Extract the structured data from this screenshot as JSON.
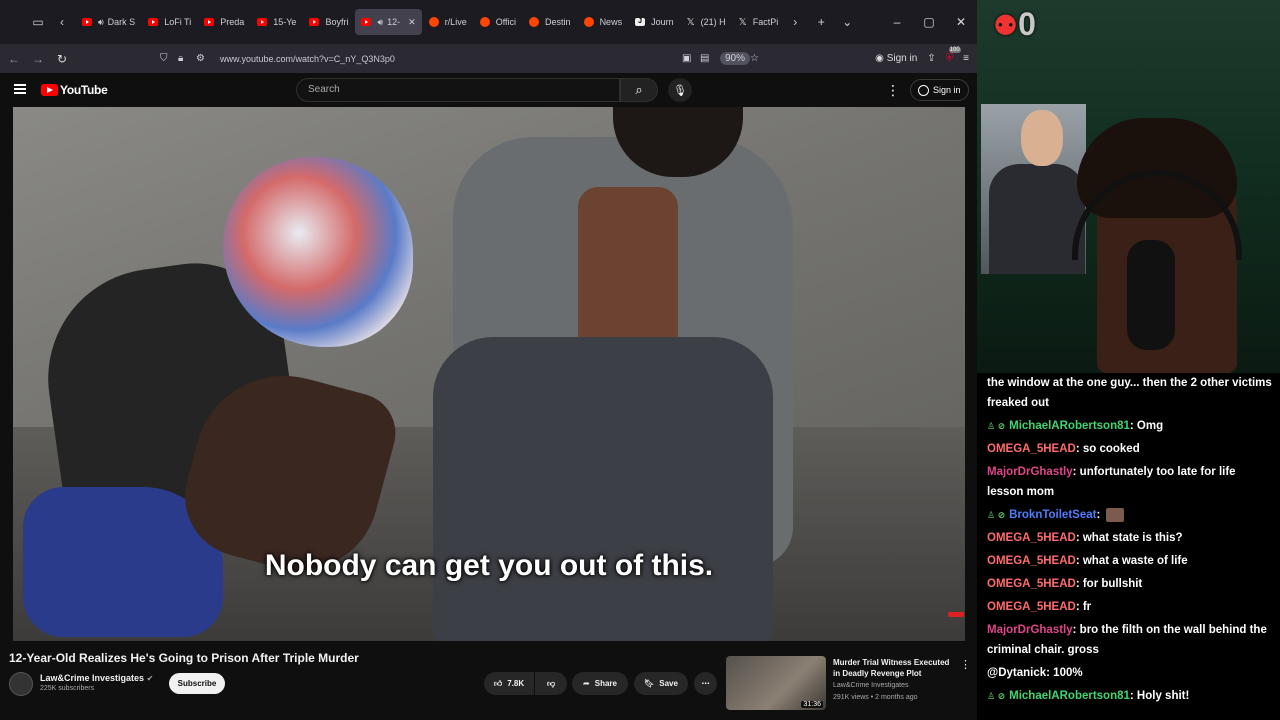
{
  "browser": {
    "tabs": [
      {
        "label": "Dark S",
        "icon": "youtube-icon",
        "audio": true
      },
      {
        "label": "LoFi Ti",
        "icon": "youtube-icon"
      },
      {
        "label": "Preda",
        "icon": "youtube-icon"
      },
      {
        "label": "15-Ye",
        "icon": "youtube-icon"
      },
      {
        "label": "Boyfri",
        "icon": "youtube-icon"
      },
      {
        "label": "12-",
        "icon": "youtube-icon",
        "active": true,
        "audio": true
      },
      {
        "label": "r/Live",
        "icon": "reddit-icon"
      },
      {
        "label": "Offici",
        "icon": "reddit-icon"
      },
      {
        "label": "Destin",
        "icon": "reddit-icon"
      },
      {
        "label": "News",
        "icon": "reddit-icon"
      },
      {
        "label": "Journ",
        "icon": "journal-icon"
      },
      {
        "label": "(21) H",
        "icon": "x-icon"
      },
      {
        "label": "FactPi",
        "icon": "x-icon"
      }
    ],
    "url": "www.youtube.com/watch?v=C_nY_Q3N3p0",
    "zoom": "90%",
    "signin_label": "Sign in",
    "badge_count": "100"
  },
  "youtube": {
    "logo_text": "YouTube",
    "search_placeholder": "Search",
    "signin_label": "Sign in",
    "subtitle": "Nobody can get you out of this.",
    "video_title": "12-Year-Old Realizes He's Going to Prison After Triple Murder",
    "channel_name": "Law&Crime Investigates",
    "channel_subs": "225K subscribers",
    "subscribe_label": "Subscribe",
    "likes": "7.8K",
    "share_label": "Share",
    "save_label": "Save",
    "side": {
      "title": "Murder Trial Witness Executed in Deadly Revenge Plot",
      "channel": "Law&Crime Investigates",
      "meta": "291K views • 2 months ago",
      "duration": "31:36"
    }
  },
  "overlay": {
    "counter": "0",
    "chat": [
      {
        "user": "",
        "text": "the window at the one guy... then the 2 other victims freaked out",
        "color": "#ffffff"
      },
      {
        "user": "MichaelARobertson81",
        "text": ": Omg",
        "color": "#3fd66e",
        "badges": true
      },
      {
        "user": "OMEGA_5HEAD",
        "text": ": so cooked",
        "color": "#ff6b6b"
      },
      {
        "user": "MajorDrGhastly",
        "text": ": unfortunately too late for life lesson mom",
        "color": "#e0458a"
      },
      {
        "user": "BroknToiletSeat",
        "text": ":",
        "color": "#4f7cff",
        "badges": true,
        "emote": true
      },
      {
        "user": "OMEGA_5HEAD",
        "text": ": what state is this?",
        "color": "#ff6b6b"
      },
      {
        "user": "OMEGA_5HEAD",
        "text": ": what a waste of life",
        "color": "#ff6b6b"
      },
      {
        "user": "OMEGA_5HEAD",
        "text": ": for bullshit",
        "color": "#ff6b6b"
      },
      {
        "user": "OMEGA_5HEAD",
        "text": ": fr",
        "color": "#ff6b6b"
      },
      {
        "user": "MajorDrGhastly",
        "text": ": bro the filth on the wall behind the criminal chair. gross",
        "color": "#e0458a"
      },
      {
        "user": "@Dytanick",
        "text": ": 100%",
        "color": "#ffffff"
      },
      {
        "user": "MichaelARobertson81",
        "text": ": Holy shit!",
        "color": "#3fd66e",
        "badges": true
      }
    ]
  }
}
